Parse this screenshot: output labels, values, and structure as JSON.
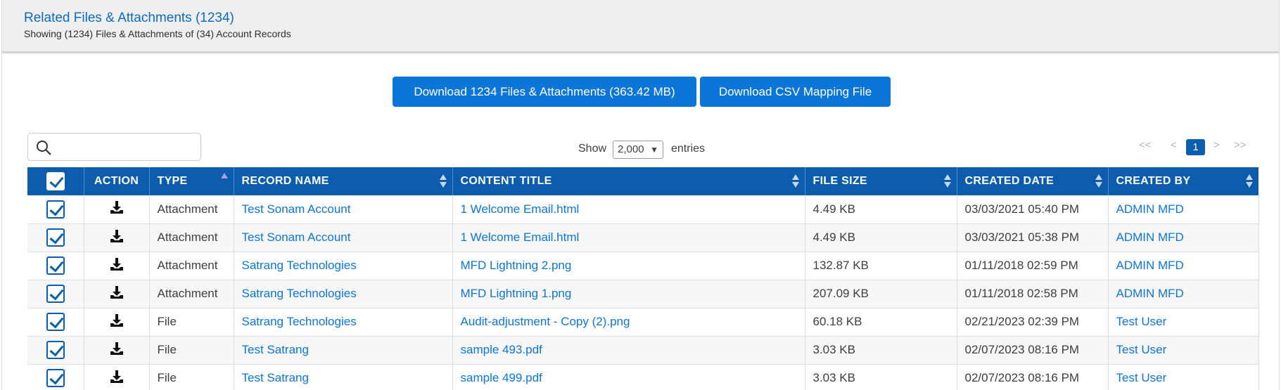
{
  "header": {
    "title": "Related Files & Attachments (1234)",
    "subtitle": "Showing (1234) Files & Attachments of (34) Account Records"
  },
  "buttons": {
    "download_label": "Download 1234 Files & Attachments (363.42 MB)",
    "csv_label": "Download CSV Mapping File"
  },
  "search": {
    "placeholder": ""
  },
  "length_menu": {
    "show_label": "Show",
    "selected": "2,000",
    "entries_label": "entries"
  },
  "pagination": {
    "first": "<<",
    "prev": "<",
    "current": "1",
    "next": ">",
    "last": ">>"
  },
  "table": {
    "columns": [
      "ACTION",
      "TYPE",
      "RECORD NAME",
      "CONTENT TITLE",
      "FILE SIZE",
      "CREATED DATE",
      "CREATED BY"
    ],
    "sorted_column": "TYPE",
    "rows": [
      {
        "type": "Attachment",
        "record": "Test Sonam Account",
        "title": "1 Welcome Email.html",
        "size": "4.49 KB",
        "date": "03/03/2021 05:40 PM",
        "by": "ADMIN MFD"
      },
      {
        "type": "Attachment",
        "record": "Test Sonam Account",
        "title": "1 Welcome Email.html",
        "size": "4.49 KB",
        "date": "03/03/2021 05:38 PM",
        "by": "ADMIN MFD"
      },
      {
        "type": "Attachment",
        "record": "Satrang Technologies",
        "title": "MFD Lightning 2.png",
        "size": "132.87 KB",
        "date": "01/11/2018 02:59 PM",
        "by": "ADMIN MFD"
      },
      {
        "type": "Attachment",
        "record": "Satrang Technologies",
        "title": "MFD Lightning 1.png",
        "size": "207.09 KB",
        "date": "01/11/2018 02:58 PM",
        "by": "ADMIN MFD"
      },
      {
        "type": "File",
        "record": "Satrang Technologies",
        "title": "Audit-adjustment - Copy (2).png",
        "size": "60.18 KB",
        "date": "02/21/2023 02:39 PM",
        "by": "Test User"
      },
      {
        "type": "File",
        "record": "Test Satrang",
        "title": "sample 493.pdf",
        "size": "3.03 KB",
        "date": "02/07/2023 08:16 PM",
        "by": "Test User"
      },
      {
        "type": "File",
        "record": "Test Satrang",
        "title": "sample 499.pdf",
        "size": "3.03 KB",
        "date": "02/07/2023 08:16 PM",
        "by": "Test User"
      }
    ]
  },
  "colors": {
    "header_blue": "#0b5cad",
    "button_blue": "#0b76d8",
    "link_blue": "#0b76d8"
  }
}
